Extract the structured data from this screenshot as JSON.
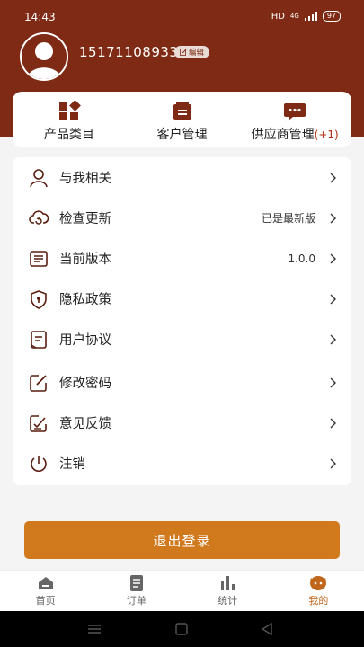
{
  "status": {
    "time": "14:43",
    "network": "HD",
    "signal": "4G",
    "battery": "97"
  },
  "profile": {
    "phone": "15171108933",
    "edit_label": "编辑"
  },
  "quick_actions": [
    {
      "label": "产品类目",
      "icon": "category-icon"
    },
    {
      "label": "客户管理",
      "icon": "customer-icon"
    },
    {
      "label": "供应商管理",
      "badge": "(+1)",
      "icon": "chat-icon"
    }
  ],
  "menu": [
    {
      "label": "与我相关",
      "value": "",
      "icon": "user-icon"
    },
    {
      "label": "检查更新",
      "value": "已是最新版",
      "icon": "cloud-refresh-icon"
    },
    {
      "label": "当前版本",
      "value": "1.0.0",
      "icon": "document-icon"
    },
    {
      "label": "隐私政策",
      "value": "",
      "icon": "shield-icon"
    },
    {
      "label": "用户协议",
      "value": "",
      "icon": "agreement-icon"
    },
    {
      "label": "修改密码",
      "value": "",
      "icon": "edit-icon"
    },
    {
      "label": "意见反馈",
      "value": "",
      "icon": "feedback-icon"
    },
    {
      "label": "注销",
      "value": "",
      "icon": "power-icon"
    }
  ],
  "logout_label": "退出登录",
  "tabs": [
    {
      "label": "首页",
      "icon": "home-icon",
      "active": false
    },
    {
      "label": "订单",
      "icon": "order-icon",
      "active": false
    },
    {
      "label": "统计",
      "icon": "stats-icon",
      "active": false
    },
    {
      "label": "我的",
      "icon": "mine-icon",
      "active": true
    }
  ],
  "colors": {
    "header": "#7f2a14",
    "accent": "#d07a1d",
    "badge": "#b32b12",
    "active_tab": "#c0661a"
  }
}
